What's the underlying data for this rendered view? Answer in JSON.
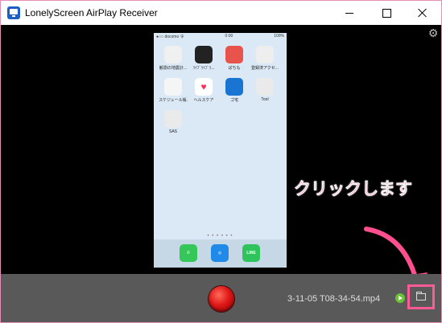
{
  "window": {
    "title": "LonelyScreen AirPlay Receiver",
    "frame_color": "#e58fb4"
  },
  "phone": {
    "status_left": "●○○ docomo 令",
    "status_time": "0:00",
    "status_right": "100%",
    "apps": [
      {
        "label": "観測の地震計..."
      },
      {
        "label": "ﾗｲﾌﾞﾗｲﾌﾞﾗ..."
      },
      {
        "label": "ぱちも"
      },
      {
        "label": "登録済アクセ..."
      },
      {
        "label": "スケジュール帳..."
      },
      {
        "label": "ヘルスケア"
      },
      {
        "label": "ゴ宅"
      },
      {
        "label": "Tool"
      },
      {
        "label": "SAS"
      }
    ],
    "page_dots": "• • • • • •",
    "dock": [
      {
        "label": "Phone",
        "color": "#35c759"
      },
      {
        "label": "Safari",
        "color": "#1f8ae8"
      },
      {
        "label": "LINE",
        "color": "#2fc45b"
      }
    ]
  },
  "annotation": {
    "text": "クリックします",
    "color": "#ff4f8e"
  },
  "controlbar": {
    "filename": "3-11-05 T08-34-54.mp4",
    "record_icon": "record-icon",
    "folder_icon": "folder-icon",
    "highlight_color": "#ff5a96"
  },
  "icons": {
    "settings": "⚙",
    "expand": "⌄"
  }
}
